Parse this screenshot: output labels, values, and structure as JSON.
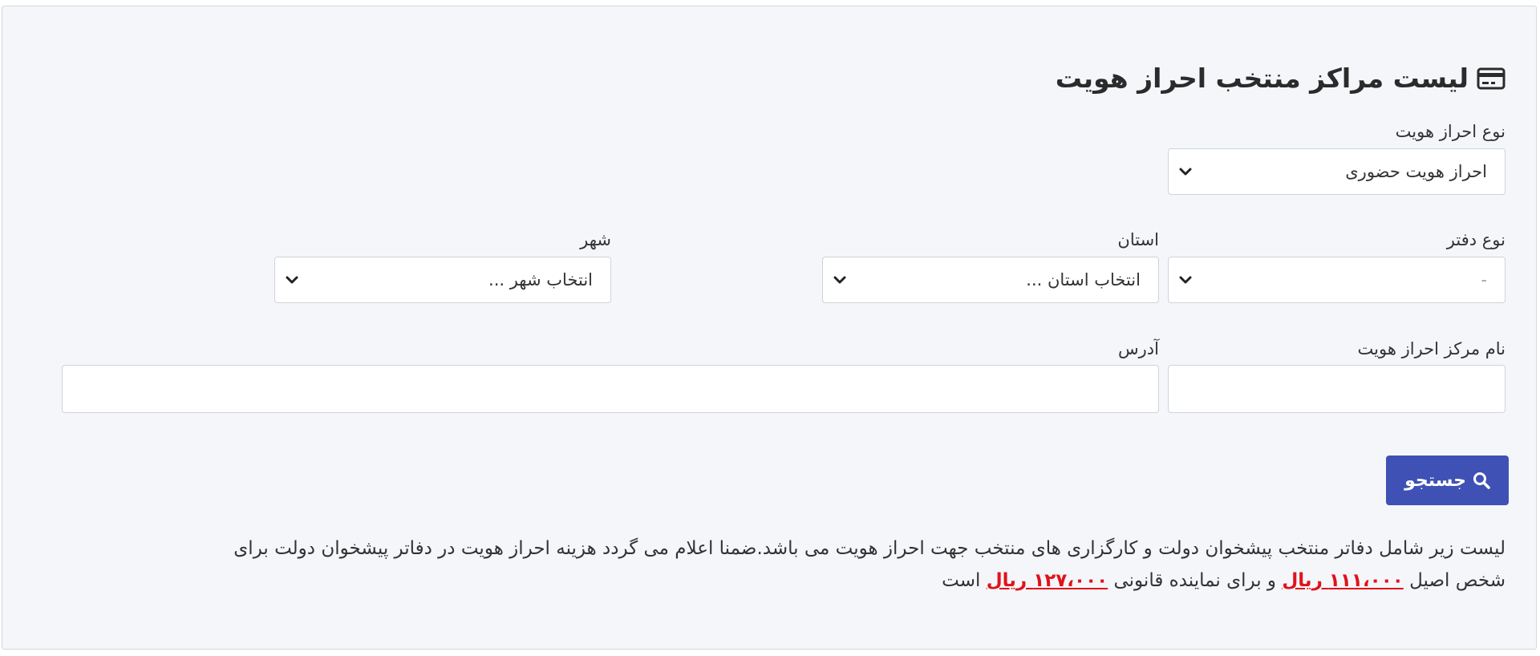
{
  "header": {
    "title": "لیست مراکز منتخب احراز هویت",
    "icon": "credit-card-icon"
  },
  "filters": {
    "verification_type": {
      "label": "نوع احراز هویت",
      "value": "احراز هویت حضوری"
    },
    "office_type": {
      "label": "نوع دفتر",
      "value": "-"
    },
    "province": {
      "label": "استان",
      "value": "انتخاب استان ..."
    },
    "city": {
      "label": "شهر",
      "value": "انتخاب شهر ..."
    },
    "center_name": {
      "label": "نام مرکز احراز هویت",
      "value": ""
    },
    "address": {
      "label": "آدرس",
      "value": ""
    }
  },
  "search": {
    "label": "جستجو",
    "icon": "search-icon",
    "color": "#3f51b5"
  },
  "notice": {
    "line1": "لیست زیر شامل دفاتر منتخب پیشخوان دولت و کارگزاری های منتخب جهت احراز هویت می باشد.ضمنا اعلام می گردد هزینه احراز هویت در دفاتر پیشخوان دولت برای",
    "part_before_price1": "شخص اصیل",
    "price_principal": "۱۱۱،۰۰۰ ریال",
    "part_between": "و برای نماینده قانونی",
    "price_representative": "۱۲۷،۰۰۰ ریال",
    "part_after": "است",
    "price_color": "#e0121b"
  }
}
